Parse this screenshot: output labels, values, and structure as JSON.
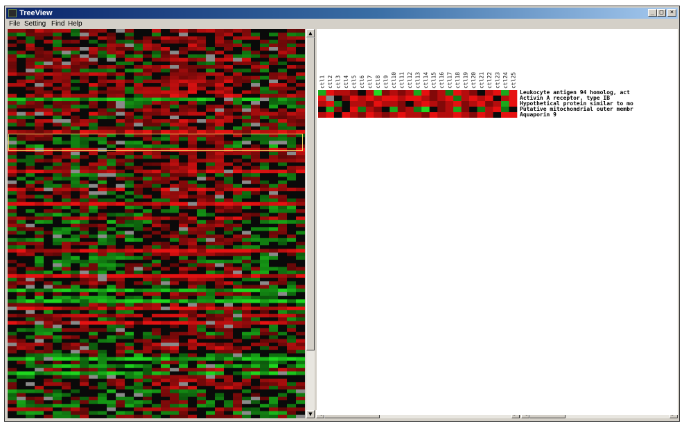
{
  "window": {
    "title": "TreeView",
    "controls": {
      "minimize": "_",
      "maximize": "□",
      "close": "×"
    }
  },
  "menubar": [
    {
      "id": "file",
      "label": "File"
    },
    {
      "id": "setting",
      "label": "Setting"
    },
    {
      "id": "find",
      "label": "Find"
    },
    {
      "id": "help",
      "label": "Help"
    }
  ],
  "colors": {
    "up": "#e51010",
    "down": "#22d822",
    "neutral": "#0a0a0a",
    "missing": "#8a8a8a",
    "selection_border": "#f0d060"
  },
  "global_view": {
    "rows": 108,
    "columns": 33,
    "selected_row_start": 29,
    "selected_row_count": 4
  },
  "zoom_view": {
    "arrays": [
      "ctl1",
      "ctl2",
      "ctl3",
      "ctl4",
      "ctl5",
      "ctl6",
      "ctl7",
      "ctl8",
      "ctl9",
      "ctl10",
      "ctl11",
      "ctl12",
      "ctl13",
      "ctl14",
      "ctl15",
      "ctl16",
      "ctl17",
      "ctl18",
      "ctl19",
      "ctl20",
      "ctl21",
      "ctl22",
      "ctl23",
      "ctl24",
      "ctl25"
    ],
    "genes": [
      "Leukocyte antigen 94 homolog, act",
      "Activin A receptor, type IB",
      "Hypothetical protein similar to mo",
      "Putative mitochondrial outer membr",
      "Aquaporin 9"
    ],
    "matrix": [
      [
        -2,
        3,
        2,
        2,
        1,
        0,
        2,
        -3,
        1,
        2,
        1,
        2,
        -2,
        3,
        1,
        2,
        -1,
        3,
        2,
        1,
        0,
        2,
        3,
        -2,
        3
      ],
      [
        3,
        -9,
        0,
        1,
        3,
        2,
        3,
        2,
        3,
        3,
        2,
        3,
        3,
        2,
        1,
        2,
        3,
        -1,
        2,
        3,
        2,
        3,
        0,
        2,
        3
      ],
      [
        2,
        3,
        -1,
        0,
        2,
        2,
        1,
        3,
        2,
        2,
        1,
        0,
        2,
        3,
        2,
        1,
        2,
        3,
        1,
        2,
        3,
        1,
        2,
        -2,
        3
      ],
      [
        0,
        -2,
        1,
        0,
        3,
        -1,
        2,
        1,
        0,
        -2,
        1,
        2,
        -1,
        -3,
        0,
        1,
        2,
        -2,
        1,
        0,
        -1,
        2,
        3,
        -1,
        0
      ],
      [
        2,
        3,
        0,
        3,
        2,
        1,
        3,
        2,
        1,
        2,
        3,
        2,
        2,
        1,
        3,
        2,
        2,
        3,
        2,
        1,
        3,
        2,
        0,
        3,
        3
      ]
    ]
  }
}
